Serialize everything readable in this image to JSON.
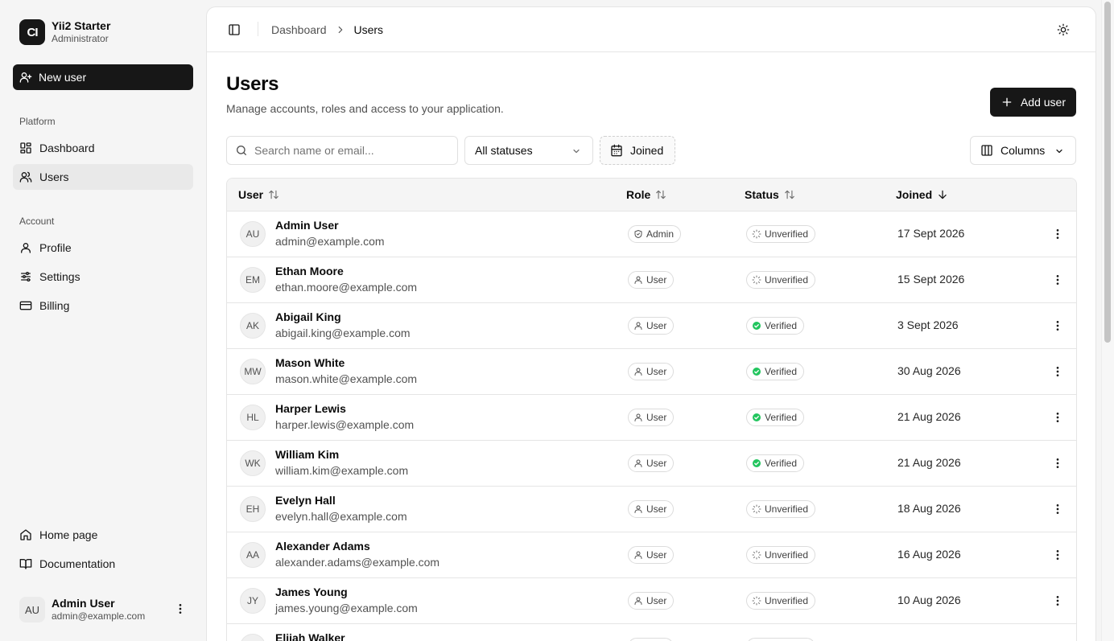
{
  "app": {
    "name": "Yii2 Starter",
    "role": "Administrator",
    "logo_text": "CI"
  },
  "sidebar": {
    "new_user_label": "New user",
    "platform_label": "Platform",
    "account_label": "Account",
    "platform_items": [
      {
        "label": "Dashboard",
        "icon": "dashboard-icon"
      },
      {
        "label": "Users",
        "icon": "users-icon",
        "active": true
      }
    ],
    "account_items": [
      {
        "label": "Profile",
        "icon": "user-icon"
      },
      {
        "label": "Settings",
        "icon": "sliders-icon"
      },
      {
        "label": "Billing",
        "icon": "credit-card-icon"
      }
    ],
    "footer_items": [
      {
        "label": "Home page",
        "icon": "home-icon"
      },
      {
        "label": "Documentation",
        "icon": "book-icon"
      }
    ],
    "user": {
      "initials": "AU",
      "name": "Admin User",
      "email": "admin@example.com"
    }
  },
  "header": {
    "breadcrumb": [
      "Dashboard",
      "Users"
    ]
  },
  "page": {
    "title": "Users",
    "subtitle": "Manage accounts, roles and access to your application.",
    "add_user_label": "Add user"
  },
  "filters": {
    "search_placeholder": "Search name or email...",
    "search_value": "",
    "status_selected": "All statuses",
    "joined_label": "Joined",
    "columns_label": "Columns"
  },
  "table": {
    "columns": [
      "User",
      "Role",
      "Status",
      "Joined"
    ],
    "rows": [
      {
        "initials": "AU",
        "name": "Admin User",
        "email": "admin@example.com",
        "role": "Admin",
        "status": "Unverified",
        "joined": "17 Sept 2026"
      },
      {
        "initials": "EM",
        "name": "Ethan Moore",
        "email": "ethan.moore@example.com",
        "role": "User",
        "status": "Unverified",
        "joined": "15 Sept 2026"
      },
      {
        "initials": "AK",
        "name": "Abigail King",
        "email": "abigail.king@example.com",
        "role": "User",
        "status": "Verified",
        "joined": "3 Sept 2026"
      },
      {
        "initials": "MW",
        "name": "Mason White",
        "email": "mason.white@example.com",
        "role": "User",
        "status": "Verified",
        "joined": "30 Aug 2026"
      },
      {
        "initials": "HL",
        "name": "Harper Lewis",
        "email": "harper.lewis@example.com",
        "role": "User",
        "status": "Verified",
        "joined": "21 Aug 2026"
      },
      {
        "initials": "WK",
        "name": "William Kim",
        "email": "william.kim@example.com",
        "role": "User",
        "status": "Verified",
        "joined": "21 Aug 2026"
      },
      {
        "initials": "EH",
        "name": "Evelyn Hall",
        "email": "evelyn.hall@example.com",
        "role": "User",
        "status": "Unverified",
        "joined": "18 Aug 2026"
      },
      {
        "initials": "AA",
        "name": "Alexander Adams",
        "email": "alexander.adams@example.com",
        "role": "User",
        "status": "Unverified",
        "joined": "16 Aug 2026"
      },
      {
        "initials": "JY",
        "name": "James Young",
        "email": "james.young@example.com",
        "role": "User",
        "status": "Unverified",
        "joined": "10 Aug 2026"
      },
      {
        "initials": "EW",
        "name": "Elijah Walker",
        "email": "",
        "role": "User",
        "status": "Unverified",
        "joined": ""
      }
    ]
  },
  "colors": {
    "primary": "#171717",
    "verified": "#22c55e",
    "muted_text": "#525252",
    "border": "#e5e5e5"
  }
}
